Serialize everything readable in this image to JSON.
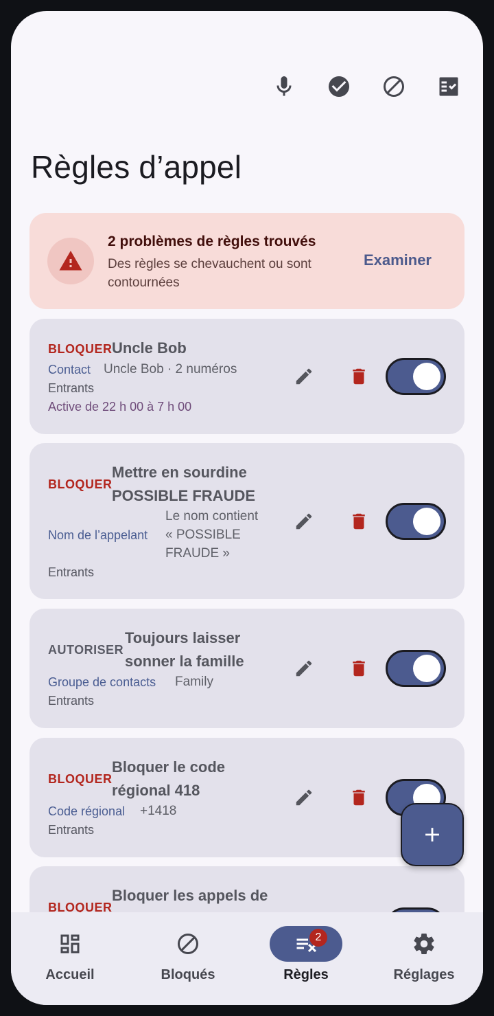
{
  "page": {
    "title": "Règles d’appel"
  },
  "toolbar": {
    "icons": [
      "mic-icon",
      "check-circle-icon",
      "block-icon",
      "checklist-icon"
    ]
  },
  "issues": {
    "title": "2 problèmes de règles trouvés",
    "description": "Des règles se chevauchent ou sont contournées",
    "action": "Examiner"
  },
  "rules": [
    {
      "verdict": "BLOQUER",
      "name": "Uncle Bob",
      "kind": "Contact",
      "detail": "Uncle Bob · 2 numéros",
      "direction": "Entrants",
      "schedule": "Active de 22 h 00 à 7 h 00",
      "enabled": true
    },
    {
      "verdict": "BLOQUER",
      "name_line1": "Mettre en sourdine",
      "name_line2": "POSSIBLE FRAUDE",
      "kind": "Nom de l’appelant",
      "detail_line1": "Le nom contient",
      "detail_line2": "« POSSIBLE",
      "detail_line3": "FRAUDE »",
      "direction": "Entrants",
      "enabled": true
    },
    {
      "verdict": "AUTORISER",
      "name_line1": "Toujours laisser",
      "name_line2": "sonner la famille",
      "kind": "Groupe de contacts",
      "detail": "Family",
      "direction": "Entrants",
      "enabled": true
    },
    {
      "verdict": "BLOQUER",
      "name_line1": "Bloquer le code",
      "name_line2": "régional 418",
      "kind": "Code régional",
      "detail": "+1418",
      "direction": "Entrants",
      "enabled": true
    },
    {
      "verdict": "BLOQUER",
      "name_line1": "Bloquer les appels de",
      "enabled": true
    }
  ],
  "nav": {
    "items": [
      {
        "label": "Accueil",
        "icon": "dashboard-icon"
      },
      {
        "label": "Bloqués",
        "icon": "block-icon"
      },
      {
        "label": "Règles",
        "icon": "rules-icon",
        "badge": "2",
        "active": true
      },
      {
        "label": "Réglages",
        "icon": "gear-icon"
      }
    ]
  },
  "colors": {
    "accent": "#4c5b8f",
    "danger": "#b3261e",
    "warning_bg": "#f8dcd9",
    "card_bg": "#e3e1eb"
  }
}
